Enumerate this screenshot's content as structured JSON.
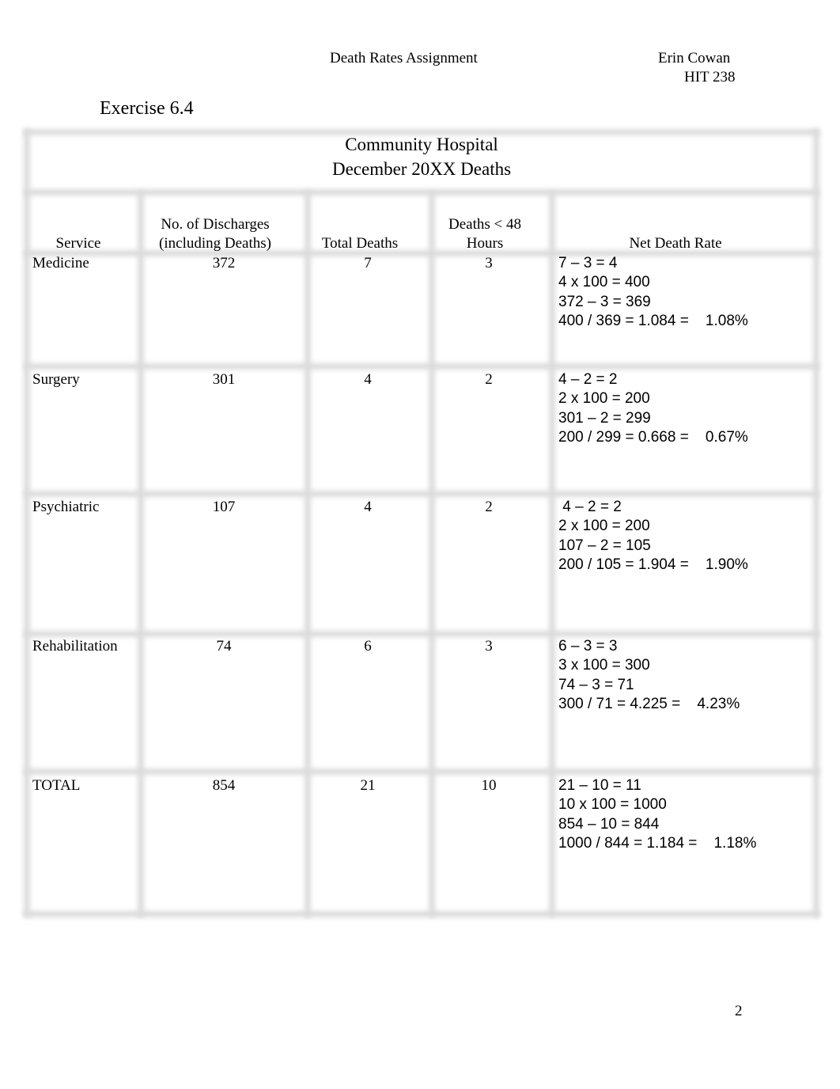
{
  "header": {
    "title": "Death Rates Assignment",
    "author": "Erin Cowan",
    "course": "HIT 238"
  },
  "exercise_label": "Exercise 6.4",
  "table": {
    "caption_line1": "Community Hospital",
    "caption_line2": "December 20XX Deaths",
    "columns": {
      "service": "Service",
      "discharges_line1": "No. of Discharges",
      "discharges_line2": "(including Deaths)",
      "total_deaths": "Total Deaths",
      "deaths48_line1": "Deaths < 48",
      "deaths48_line2": "Hours",
      "net_rate": "Net Death Rate"
    },
    "rows": [
      {
        "service": "Medicine",
        "discharges": "372",
        "total_deaths": "7",
        "deaths_48": "3",
        "calc": [
          "7 – 3 = 4",
          "4 x 100 = 400",
          "372 – 3 = 369",
          "400 / 369 = 1.084 =    1.08%"
        ]
      },
      {
        "service": "Surgery",
        "discharges": "301",
        "total_deaths": "4",
        "deaths_48": "2",
        "calc": [
          "4 – 2 = 2",
          "2 x 100 = 200",
          "301 – 2 = 299",
          "200 / 299 = 0.668 =    0.67%"
        ]
      },
      {
        "service": "Psychiatric",
        "discharges": "107",
        "total_deaths": "4",
        "deaths_48": "2",
        "calc": [
          " 4 – 2 = 2",
          "2 x 100 = 200",
          "107 – 2 = 105",
          "200 / 105 = 1.904 =    1.90%"
        ]
      },
      {
        "service": "Rehabilitation",
        "discharges": "74",
        "total_deaths": "6",
        "deaths_48": "3",
        "calc": [
          "6 – 3 = 3",
          "3 x 100 = 300",
          "74 – 3 = 71",
          "300 / 71 = 4.225 =    4.23%"
        ]
      },
      {
        "service": "TOTAL",
        "discharges": "854",
        "total_deaths": "21",
        "deaths_48": "10",
        "calc": [
          "21 – 10 = 11",
          "10 x 100 = 1000",
          "854 – 10 = 844",
          "1000 / 844 = 1.184 =    1.18%"
        ]
      }
    ]
  },
  "page_number": "2"
}
